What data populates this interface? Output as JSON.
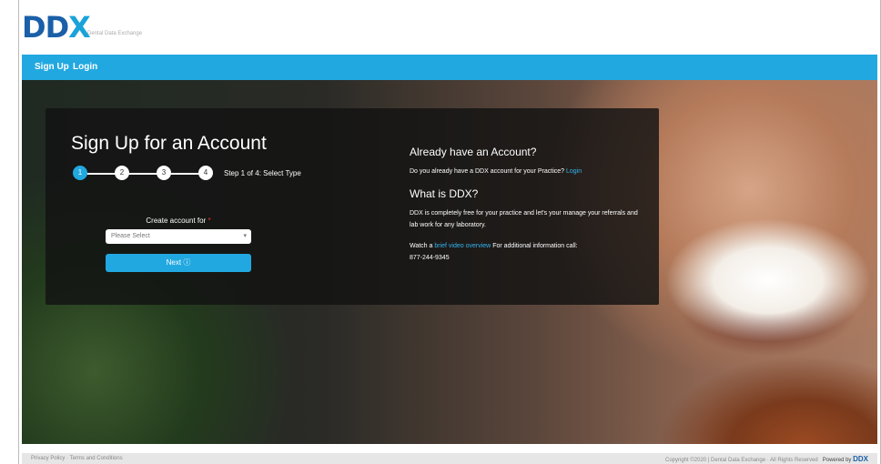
{
  "header": {
    "logo_main": "DD",
    "logo_x": "X",
    "tagline": "Dental Data Exchange"
  },
  "nav": {
    "signup_label": "Sign Up",
    "login_label": "Login"
  },
  "signup": {
    "title": "Sign Up for an Account",
    "steps": [
      "1",
      "2",
      "3",
      "4"
    ],
    "active_step": 1,
    "step_text": "Step 1 of 4: Select Type",
    "create_label": "Create account for",
    "required_mark": "*",
    "select_value": "Please Select",
    "next_label": "Next ⓘ"
  },
  "info": {
    "already_title": "Already have an Account?",
    "already_text": "Do you already have a DDX account for your Practice?",
    "login_link": "Login",
    "what_title": "What is DDX?",
    "what_text": "DDX is completely free for your practice and let's your manage your referrals and lab work for any laboratory.",
    "watch_prefix": "Watch a",
    "video_link": "brief video overview",
    "watch_suffix": "For additional information call:",
    "phone": "877-244-9345"
  },
  "footer": {
    "left_links": "Privacy Policy · Terms and Conditions",
    "copyright": "Copyright ©2020 | Dental Data Exchange · All Rights Reserved",
    "powered_by": "Powered by",
    "powered_brand": "DDX"
  },
  "colors": {
    "brand_blue": "#1a5fa8",
    "accent": "#22a8e0"
  }
}
